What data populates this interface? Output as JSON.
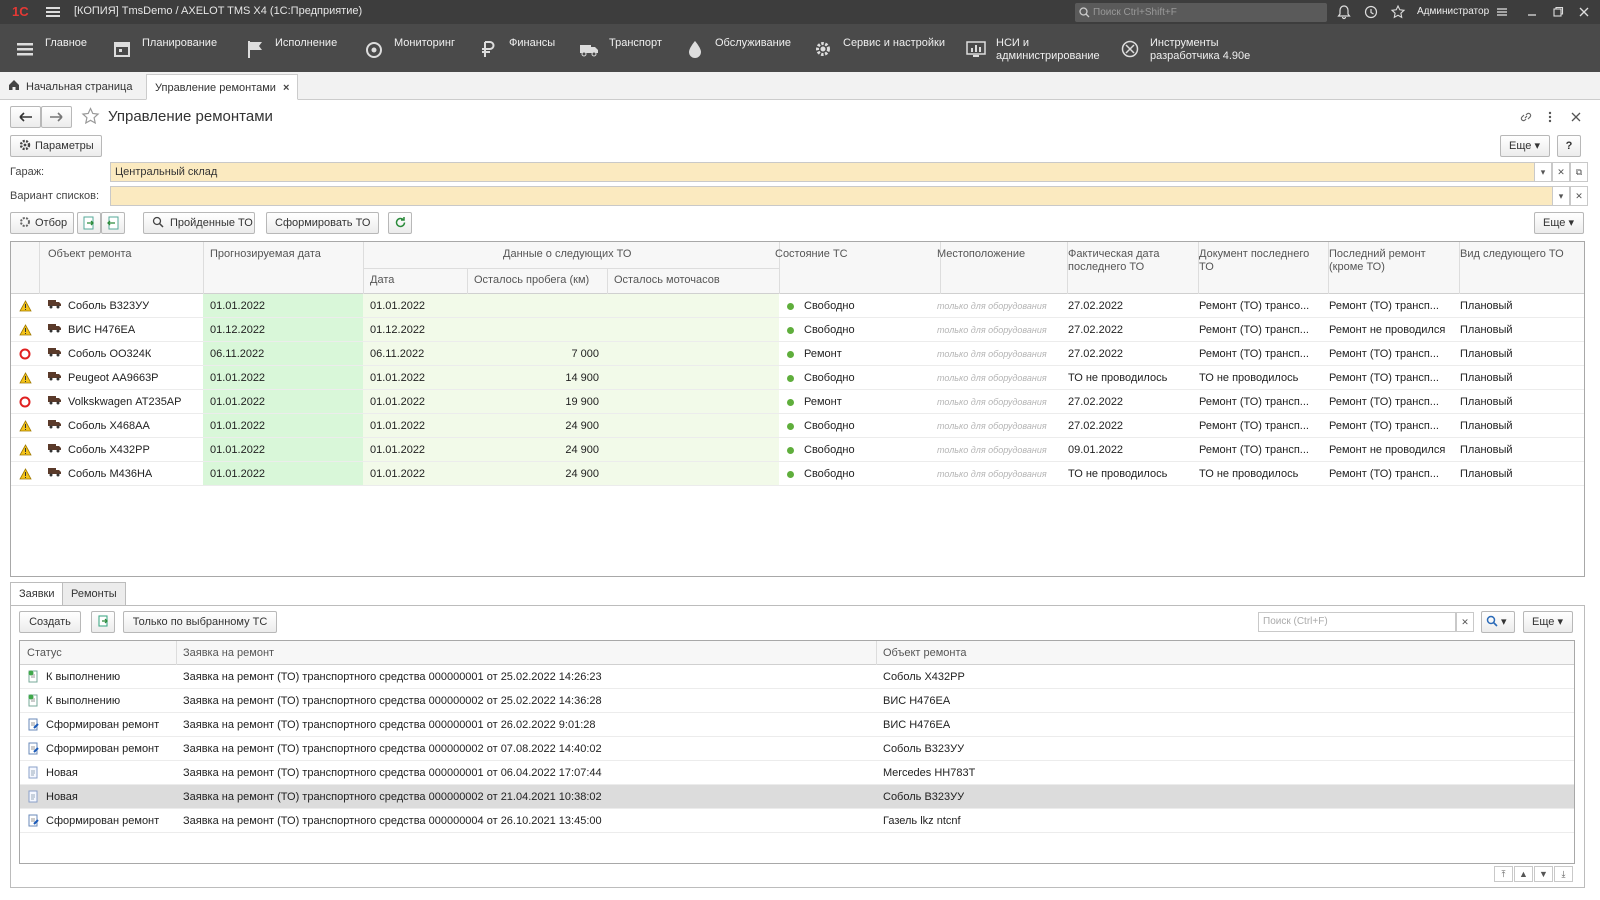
{
  "window": {
    "logo": "1С",
    "title": "[КОПИЯ] TmsDemo / AXELOT TMS X4  (1С:Предприятие)",
    "search_placeholder": "Поиск Ctrl+Shift+F",
    "user": "Администратор"
  },
  "sections": [
    {
      "label": "Главное",
      "icon": "menu-icon"
    },
    {
      "label": "Планирование",
      "icon": "calendar-icon"
    },
    {
      "label": "Исполнение",
      "icon": "flag-icon"
    },
    {
      "label": "Мониторинг",
      "icon": "monitoring-icon"
    },
    {
      "label": "Финансы",
      "icon": "ruble-icon"
    },
    {
      "label": "Транспорт",
      "icon": "truck-icon"
    },
    {
      "label": "Обслуживание",
      "icon": "drop-icon"
    },
    {
      "label": "Сервис и настройки",
      "icon": "gear-icon"
    },
    {
      "label1": "НСИ и",
      "label2": "администрирование",
      "icon": "chart-icon"
    },
    {
      "label1": "Инструменты",
      "label2": "разработчика 4.90e",
      "icon": "tools-icon"
    }
  ],
  "tabs": {
    "home": "Начальная страница",
    "current": "Управление ремонтами"
  },
  "form": {
    "title": "Управление ремонтами",
    "params_btn": "Параметры",
    "more": "Еще",
    "help": "?",
    "garage_label": "Гараж:",
    "garage_value": "Центральный склад",
    "variant_label": "Вариант списков:",
    "variant_value": "",
    "filter_btn": "Отбор",
    "passed_btn": "Пройденные ТО",
    "form_btn": "Сформировать ТО"
  },
  "main_grid": {
    "headers": {
      "object": "Объект ремонта",
      "forecast": "Прогнозируемая дата",
      "next_group": "Данные о следующих ТО",
      "date": "Дата",
      "mileage": "Осталось пробега (км)",
      "hours": "Осталось моточасов",
      "state": "Состояние ТС",
      "location": "Местоположение",
      "fact1": "Фактическая дата",
      "fact2": "последнего ТО",
      "doc1": "Документ последнего",
      "doc2": "ТО",
      "last1": "Последний ремонт",
      "last2": "(кроме ТО)",
      "kind": "Вид следующего ТО"
    },
    "rows": [
      {
        "status": "warn",
        "object": "Соболь В323УУ",
        "forecast": "01.01.2022",
        "date": "01.01.2022",
        "mileage": "",
        "hours": "",
        "state": "Свободно",
        "location": "только для оборудования",
        "fact": "27.02.2022",
        "doc": "Ремонт (ТО) трансо...",
        "last": "Ремонт (ТО) трансп...",
        "kind": "Плановый"
      },
      {
        "status": "warn",
        "object": "ВИС Н476ЕА",
        "forecast": "01.12.2022",
        "date": "01.12.2022",
        "mileage": "",
        "hours": "",
        "state": "Свободно",
        "location": "только для оборудования",
        "fact": "27.02.2022",
        "doc": "Ремонт (ТО) трансп...",
        "last": "Ремонт не проводился",
        "kind": "Плановый"
      },
      {
        "status": "stop",
        "object": "Соболь ОО324К",
        "forecast": "06.11.2022",
        "date": "06.11.2022",
        "mileage": "7 000",
        "hours": "",
        "state": "Ремонт",
        "location": "только для оборудования",
        "fact": "27.02.2022",
        "doc": "Ремонт (ТО) трансп...",
        "last": "Ремонт (ТО) трансп...",
        "kind": "Плановый"
      },
      {
        "status": "warn",
        "object": "Peugeot АА9663Р",
        "forecast": "01.01.2022",
        "date": "01.01.2022",
        "mileage": "14 900",
        "hours": "",
        "state": "Свободно",
        "location": "только для оборудования",
        "fact": "ТО не проводилось",
        "doc": "ТО не проводилось",
        "last": "Ремонт (ТО) трансп...",
        "kind": "Плановый"
      },
      {
        "status": "stop",
        "object": "Volkskwagen АТ235АР",
        "forecast": "01.01.2022",
        "date": "01.01.2022",
        "mileage": "19 900",
        "hours": "",
        "state": "Ремонт",
        "location": "только для оборудования",
        "fact": "27.02.2022",
        "doc": "Ремонт (ТО) трансп...",
        "last": "Ремонт (ТО) трансп...",
        "kind": "Плановый"
      },
      {
        "status": "warn",
        "object": "Соболь Х468АА",
        "forecast": "01.01.2022",
        "date": "01.01.2022",
        "mileage": "24 900",
        "hours": "",
        "state": "Свободно",
        "location": "только для оборудования",
        "fact": "27.02.2022",
        "doc": "Ремонт (ТО) трансп...",
        "last": "Ремонт (ТО) трансп...",
        "kind": "Плановый"
      },
      {
        "status": "warn",
        "object": "Соболь Х432РР",
        "forecast": "01.01.2022",
        "date": "01.01.2022",
        "mileage": "24 900",
        "hours": "",
        "state": "Свободно",
        "location": "только для оборудования",
        "fact": "09.01.2022",
        "doc": "Ремонт (ТО) трансп...",
        "last": "Ремонт не проводился",
        "kind": "Плановый"
      },
      {
        "status": "warn",
        "object": "Соболь М436НА",
        "forecast": "01.01.2022",
        "date": "01.01.2022",
        "mileage": "24 900",
        "hours": "",
        "state": "Свободно",
        "location": "только для оборудования",
        "fact": "ТО не проводилось",
        "doc": "ТО не проводилось",
        "last": "Ремонт (ТО) трансп...",
        "kind": "Плановый"
      }
    ]
  },
  "bottom": {
    "tab_requests": "Заявки",
    "tab_repairs": "Ремонты",
    "create_btn": "Создать",
    "only_selected_btn": "Только по выбранному ТС",
    "search_placeholder": "Поиск (Ctrl+F)",
    "more": "Еще",
    "headers": {
      "status": "Статус",
      "request": "Заявка на ремонт",
      "object": "Объект ремонта"
    },
    "rows": [
      {
        "icon": "green",
        "status": "К выполнению",
        "request": "Заявка на ремонт (ТО) транспортного средства 000000001 от 25.02.2022 14:26:23",
        "object": "Соболь Х432РР"
      },
      {
        "icon": "green",
        "status": "К выполнению",
        "request": "Заявка на ремонт (ТО) транспортного средства 000000002 от 25.02.2022 14:36:28",
        "object": "ВИС Н476ЕА"
      },
      {
        "icon": "blue",
        "status": "Сформирован ремонт",
        "request": "Заявка на ремонт (ТО) транспортного средства 000000001 от 26.02.2022 9:01:28",
        "object": "ВИС Н476ЕА"
      },
      {
        "icon": "blue",
        "status": "Сформирован ремонт",
        "request": "Заявка на ремонт (ТО) транспортного средства 000000002 от 07.08.2022 14:40:02",
        "object": "Соболь В323УУ"
      },
      {
        "icon": "doc",
        "status": "Новая",
        "request": "Заявка на ремонт (ТО) транспортного средства 000000001 от 06.04.2022 17:07:44",
        "object": "Mercedes НН783Т"
      },
      {
        "icon": "doc",
        "status": "Новая",
        "request": "Заявка на ремонт (ТО) транспортного средства 000000002 от 21.04.2021 10:38:02",
        "object": "Соболь В323УУ"
      },
      {
        "icon": "blue",
        "status": "Сформирован ремонт",
        "request": "Заявка на ремонт (ТО) транспортного средства 000000004 от 26.10.2021 13:45:00",
        "object": "Газель lkz ntcnf"
      }
    ]
  },
  "colors": {
    "accent_red": "#e53935",
    "field_yellow": "#fbeac0",
    "green_col": "#d9f7d9",
    "light_green_col": "#f2fae9",
    "selected_row": "#dcdcdc"
  }
}
